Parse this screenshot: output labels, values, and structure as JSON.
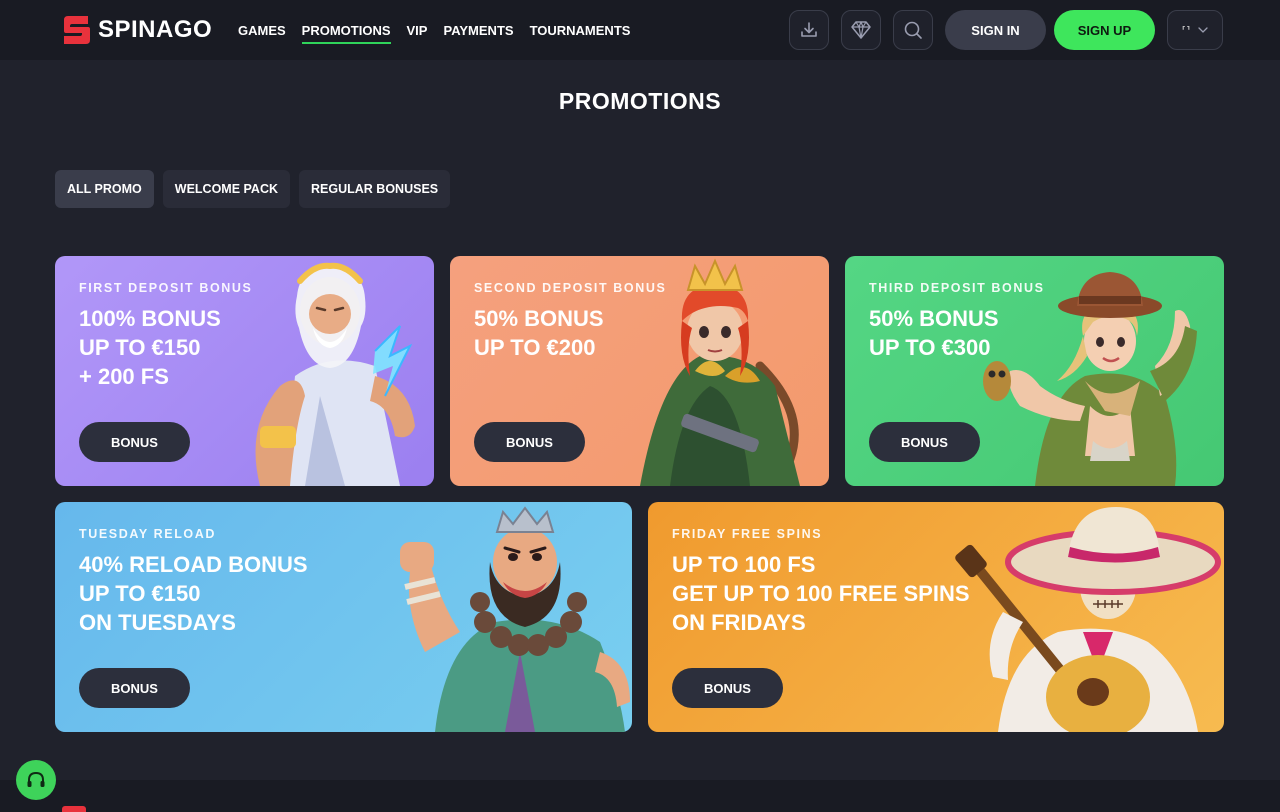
{
  "header": {
    "logo_text": "SPINAGO",
    "nav": [
      {
        "label": "GAMES"
      },
      {
        "label": "PROMOTIONS"
      },
      {
        "label": "VIP"
      },
      {
        "label": "PAYMENTS"
      },
      {
        "label": "TOURNAMENTS"
      }
    ],
    "active_nav": "PROMOTIONS",
    "icons": [
      "download-icon",
      "diamond-icon",
      "search-icon"
    ],
    "sign_in_label": "SIGN IN",
    "sign_up_label": "SIGN UP",
    "language_flag": "⸢⸣",
    "accent_color": "#3ee65c"
  },
  "page": {
    "title": "PROMOTIONS"
  },
  "filters": [
    {
      "label": "ALL PROMO",
      "active": true
    },
    {
      "label": "WELCOME PACK",
      "active": false
    },
    {
      "label": "REGULAR BONUSES",
      "active": false
    }
  ],
  "cards": [
    {
      "label": "FIRST DEPOSIT BONUS",
      "headline": [
        "100% BONUS",
        "UP TO €150",
        "+ 200 FS"
      ],
      "button": "BONUS",
      "color": "#a78bf2",
      "art": "zeus-character"
    },
    {
      "label": "SECOND DEPOSIT BONUS",
      "headline": [
        "50% BONUS",
        "UP TO €200"
      ],
      "button": "BONUS",
      "color": "#f59e76",
      "art": "archer-girl-character"
    },
    {
      "label": "THIRD DEPOSIT BONUS",
      "headline": [
        "50% BONUS",
        "UP TO €300"
      ],
      "button": "BONUS",
      "color": "#4fd07c",
      "art": "explorer-woman-character"
    },
    {
      "label": "TUESDAY RELOAD",
      "headline": [
        "40% RELOAD BONUS",
        "UP TO €150",
        "ON TUESDAYS"
      ],
      "button": "BONUS",
      "color": "#6ec2ee",
      "art": "bearded-monk-character"
    },
    {
      "label": "FRIDAY FREE SPINS",
      "headline": [
        "UP TO 100 FS",
        "GET UP TO 100 FREE SPINS",
        "ON FRIDAYS"
      ],
      "button": "BONUS",
      "color": "#f5a93e",
      "art": "mariachi-skeleton-character"
    }
  ],
  "support": {
    "icon": "headset-icon"
  }
}
